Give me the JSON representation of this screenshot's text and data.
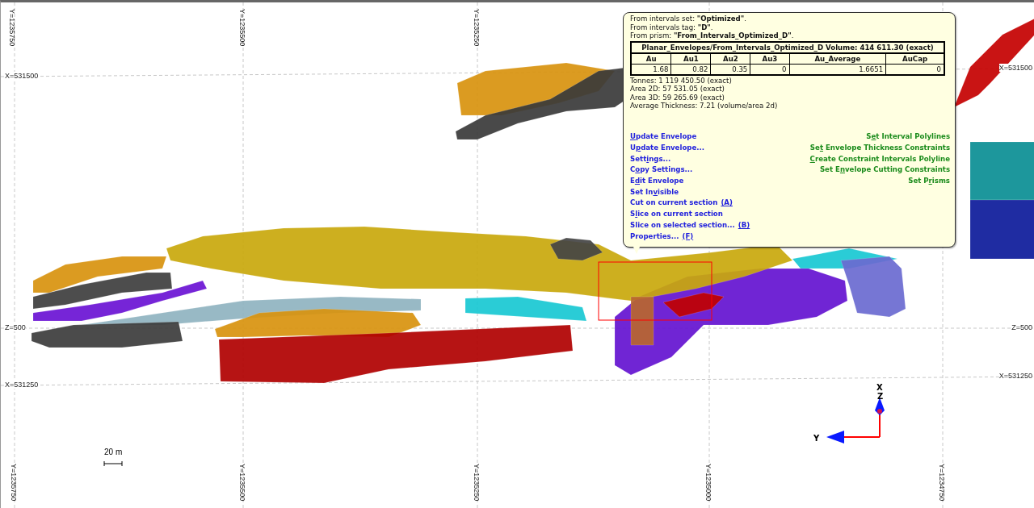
{
  "grid_labels": {
    "top": [
      "Y=1235750",
      "Y=1235500",
      "Y=1235250"
    ],
    "bottom": [
      "Y=1235750",
      "Y=1235500",
      "Y=1235250",
      "Y=1235000",
      "Y=1234750"
    ],
    "left": [
      "X=531500",
      "Z=500",
      "X=531250"
    ],
    "right": [
      "X=531500",
      "Z=500",
      "X=531250"
    ]
  },
  "scale_bar": {
    "label": "20 m"
  },
  "axis_triad": {
    "x_label": "X",
    "z_label": "Z",
    "y_label": "Y"
  },
  "tooltip": {
    "lines": [
      "From intervals set: **\"Optimized\"**.",
      "From intervals tag: **\"D\"**.",
      "From prism: **\"From_Intervals_Optimized_D\"**."
    ],
    "table": {
      "title": "Planar_Envelopes/From_Intervals_Optimized_D Volume: 414 611.30 (exact)",
      "columns": [
        "Au",
        "Au1",
        "Au2",
        "Au3",
        "Au_Average",
        "AuCap"
      ],
      "values": [
        "1.68",
        "0.82",
        "0.35",
        "0",
        "1.6651",
        "0"
      ]
    },
    "stats": [
      "Tonnes: 1 119 450.50 (exact)",
      "Area 2D: 57 531.05 (exact)",
      "Area 3D: 59 265.69 (exact)",
      "Average Thickness: 7.21 (volume/area 2d)"
    ],
    "left_actions": [
      {
        "key": "U",
        "post": "pdate Envelope"
      },
      {
        "pre": "U",
        "key": "p",
        "post": "date Envelope..."
      },
      {
        "pre": "Sett",
        "key": "i",
        "post": "ngs..."
      },
      {
        "pre": "C",
        "key": "o",
        "post": "py Settings..."
      },
      {
        "pre": "E",
        "key": "d",
        "post": "it Envelope"
      },
      {
        "pre": "Set In",
        "key": "v",
        "post": "isible"
      },
      {
        "pre": "Cut on current section",
        "shortcut": "(A)"
      },
      {
        "pre": "S",
        "key": "l",
        "post": "ice on current section"
      },
      {
        "pre": "Slice on selected section...",
        "shortcut": "(B)"
      },
      {
        "pre": "Properties...",
        "shortcut": "(F)"
      }
    ],
    "right_actions": [
      {
        "pre": "S",
        "key": "e",
        "post": "t Interval Polylines"
      },
      {
        "pre": "Se",
        "key": "t",
        "post": " Envelope Thickness Constraints"
      },
      {
        "key": "C",
        "post": "reate Constraint Intervals Polyline"
      },
      {
        "pre": "Set E",
        "key": "n",
        "post": "velope Cutting Constraints"
      },
      {
        "pre": "Set P",
        "key": "r",
        "post": "isms"
      }
    ]
  }
}
